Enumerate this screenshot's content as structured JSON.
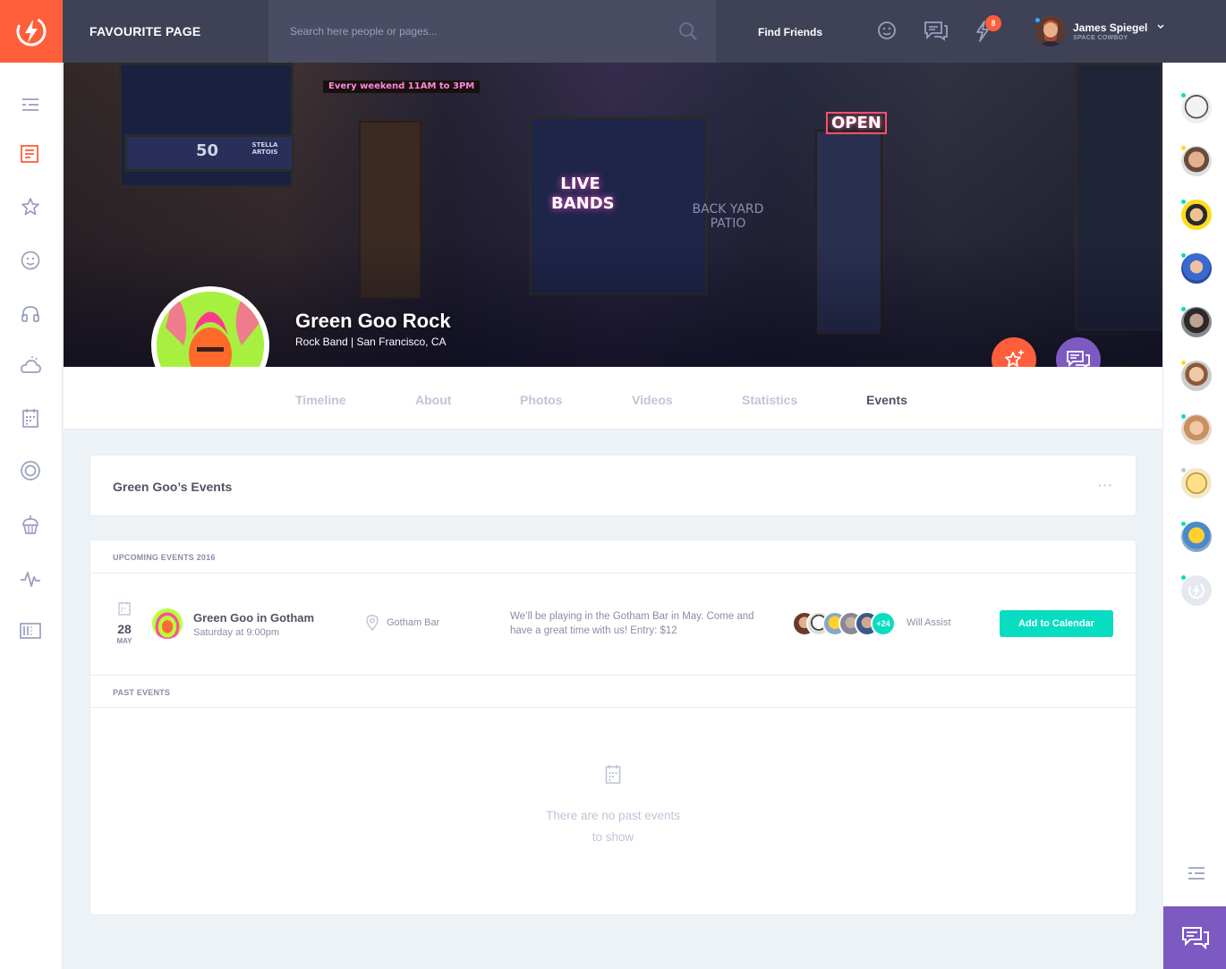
{
  "header": {
    "page_title": "FAVOURITE PAGE",
    "search_placeholder": "Search here people or pages...",
    "find_friends": "Find Friends",
    "notification_count": "8",
    "user": {
      "name": "James Spiegel",
      "subtitle": "SPACE COWBOY"
    }
  },
  "colors": {
    "brand": "#ff5e3a",
    "topbar": "#3f4257",
    "purple": "#7c5ac2",
    "teal": "#08ddc1",
    "blue": "#38a9ff",
    "yellow": "#ffdc1b"
  },
  "left_sidebar": {
    "icons": [
      "menu-icon",
      "newsfeed-icon",
      "star-icon",
      "happy-face-icon",
      "headphones-icon",
      "weather-icon",
      "calendar-icon",
      "badge-icon",
      "cupcake-icon",
      "stats-icon",
      "manage-widgets-icon"
    ]
  },
  "cover": {
    "neon_texts": [
      "Every weekend 11AM to 3PM",
      "LIVE BANDS",
      "OPEN",
      "BACK YARD PATIO",
      "STELLA ARTOIS",
      "50"
    ]
  },
  "profile": {
    "name": "Green Goo Rock",
    "subtitle": "Rock Band  |  San Francisco, CA"
  },
  "tabs": [
    {
      "label": "Timeline",
      "active": false
    },
    {
      "label": "About",
      "active": false
    },
    {
      "label": "Photos",
      "active": false
    },
    {
      "label": "Videos",
      "active": false
    },
    {
      "label": "Statistics",
      "active": false
    },
    {
      "label": "Events",
      "active": true
    }
  ],
  "events_header": {
    "title": "Green Goo’s Events",
    "more": "···"
  },
  "events": {
    "upcoming_label": "UPCOMING EVENTS 2016",
    "upcoming": [
      {
        "day": "28",
        "month": "MAY",
        "title": "Green Goo in Gotham",
        "time": "Saturday at 9:00pm",
        "location": "Gotham Bar",
        "description": "We’ll be playing in the Gotham Bar in May. Come and have a great time with us! Entry: $12",
        "attendees_more": "+24",
        "will_assist": "Will Assist",
        "button": "Add to Calendar"
      }
    ],
    "past_label": "PAST EVENTS",
    "empty_line1": "There are no past events",
    "empty_line2": "to show"
  },
  "friends_online": [
    {
      "status": "teal"
    },
    {
      "status": "yellow"
    },
    {
      "status": "teal"
    },
    {
      "status": "teal"
    },
    {
      "status": "teal"
    },
    {
      "status": "yellow"
    },
    {
      "status": "teal"
    },
    {
      "status": "grey"
    },
    {
      "status": "teal"
    },
    {
      "status": "teal"
    }
  ]
}
